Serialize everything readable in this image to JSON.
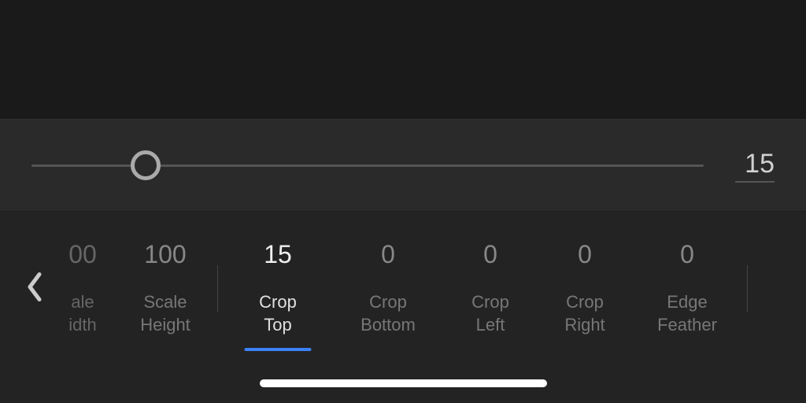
{
  "slider": {
    "value": "15",
    "handle_position_percent": 17
  },
  "params": [
    {
      "id": "scale-width",
      "value": "00",
      "label": "ale\nidth",
      "state": "partial",
      "width_class": "w-90"
    },
    {
      "id": "scale-height",
      "value": "100",
      "label": "Scale\nHeight",
      "state": "inactive",
      "width_class": "w-120"
    },
    {
      "id": "crop-top",
      "value": "15",
      "label": "Crop\nTop",
      "state": "active",
      "width_class": "w-140"
    },
    {
      "id": "crop-bottom",
      "value": "0",
      "label": "Crop\nBottom",
      "state": "inactive",
      "width_class": "w-140"
    },
    {
      "id": "crop-left",
      "value": "0",
      "label": "Crop\nLeft",
      "state": "inactive",
      "width_class": "w-120"
    },
    {
      "id": "crop-right",
      "value": "0",
      "label": "Crop\nRight",
      "state": "inactive",
      "width_class": "w-120"
    },
    {
      "id": "edge-feather",
      "value": "0",
      "label": "Edge\nFeather",
      "state": "inactive",
      "width_class": "w-140"
    }
  ],
  "colors": {
    "accent": "#3b82f6"
  }
}
